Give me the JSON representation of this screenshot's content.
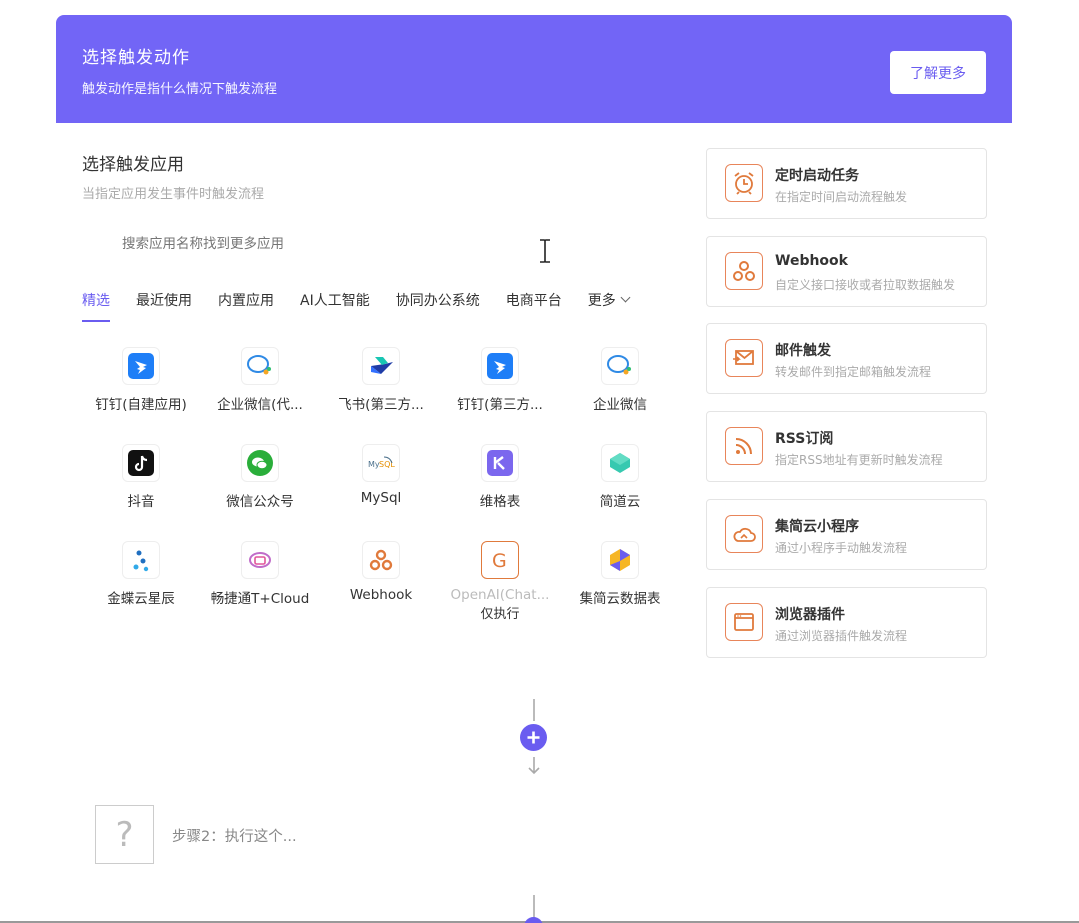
{
  "banner": {
    "title": "选择触发动作",
    "subtitle": "触发动作是指什么情况下触发流程",
    "learn_more": "了解更多"
  },
  "section": {
    "title": "选择触发应用",
    "subtitle": "当指定应用发生事件时触发流程"
  },
  "search": {
    "placeholder": "搜索应用名称找到更多应用"
  },
  "tabs": [
    {
      "label": "精选",
      "active": true
    },
    {
      "label": "最近使用"
    },
    {
      "label": "内置应用"
    },
    {
      "label": "AI人工智能"
    },
    {
      "label": "协同办公系统"
    },
    {
      "label": "电商平台"
    },
    {
      "label": "更多"
    }
  ],
  "apps": [
    {
      "label": "钉钉(自建应用)",
      "icon": "dingtalk-icon"
    },
    {
      "label": "企业微信(代...",
      "icon": "wecom-icon"
    },
    {
      "label": "飞书(第三方...",
      "icon": "feishu-icon"
    },
    {
      "label": "钉钉(第三方...",
      "icon": "dingtalk-icon"
    },
    {
      "label": "企业微信",
      "icon": "wecom-icon"
    },
    {
      "label": "抖音",
      "icon": "douyin-icon"
    },
    {
      "label": "微信公众号",
      "icon": "wechat-icon"
    },
    {
      "label": "MySql",
      "icon": "mysql-icon"
    },
    {
      "label": "维格表",
      "icon": "vika-icon"
    },
    {
      "label": "简道云",
      "icon": "jiandaoyun-icon"
    },
    {
      "label": "金蝶云星辰",
      "icon": "kingdee-icon"
    },
    {
      "label": "畅捷通T+Cloud",
      "icon": "chanjet-icon"
    },
    {
      "label": "Webhook",
      "icon": "webhook-icon"
    },
    {
      "label": "OpenAI(Chat...",
      "sub": "仅执行",
      "icon": "openai-icon",
      "disabled": true
    },
    {
      "label": "集简云数据表",
      "icon": "jijianyun-table-icon"
    }
  ],
  "triggers": [
    {
      "title": "定时启动任务",
      "desc": "在指定时间启动流程触发",
      "icon": "alarm-clock-icon"
    },
    {
      "title": "Webhook",
      "desc": "自定义接口接收或者拉取数据触发",
      "icon": "webhook-icon"
    },
    {
      "title": "邮件触发",
      "desc": "转发邮件到指定邮箱触发流程",
      "icon": "mail-icon"
    },
    {
      "title": "RSS订阅",
      "desc": "指定RSS地址有更新时触发流程",
      "icon": "rss-icon"
    },
    {
      "title": "集简云小程序",
      "desc": "通过小程序手动触发流程",
      "icon": "cloud-icon"
    },
    {
      "title": "浏览器插件",
      "desc": "通过浏览器插件触发流程",
      "icon": "browser-icon"
    }
  ],
  "step2": {
    "label": "步骤2：执行这个...",
    "placeholder_glyph": "?"
  },
  "colors": {
    "brand": "#7265f6",
    "accent": "#6a5cf0",
    "trigger_icon": "#e8855a"
  }
}
